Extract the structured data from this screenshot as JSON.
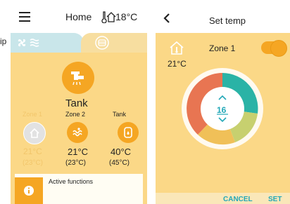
{
  "left_stub": {
    "text": "ip"
  },
  "home": {
    "title": "Home",
    "outdoor_temp": "18°C",
    "tank_label": "Tank",
    "zones": [
      {
        "label": "Zone 1",
        "current": "21°C",
        "target": "(23°C)",
        "state": "disabled"
      },
      {
        "label": "Zone 2",
        "current": "21°C",
        "target": "(23°C)",
        "state": "active"
      },
      {
        "label": "Tank",
        "current": "40°C",
        "target": "(45°C)",
        "state": "active"
      }
    ],
    "active_functions": "Active functions"
  },
  "set_temp": {
    "title": "Set temp",
    "zone_label": "Zone 1",
    "zone_temp": "21°C",
    "setpoint": "16",
    "cancel": "CANCEL",
    "set": "SET",
    "toggle_on": true
  },
  "colors": {
    "yellow": "#fbd887",
    "orange": "#f5a623",
    "teal": "#2ab3a6",
    "link": "#23a8b8"
  }
}
